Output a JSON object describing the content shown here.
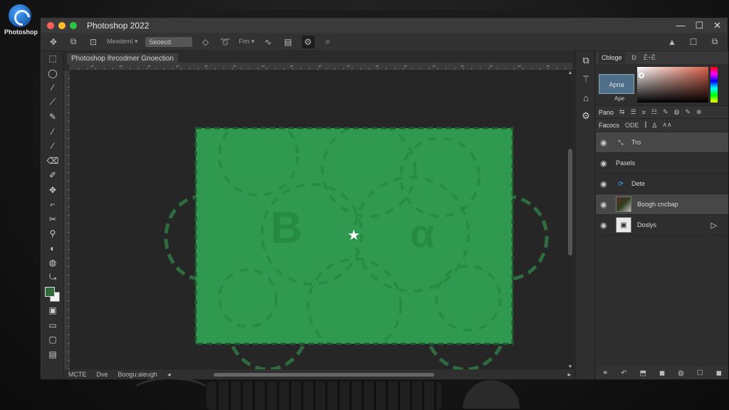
{
  "app": {
    "name": "Photoshop 2022",
    "logo_label": "Photoshop"
  },
  "window_controls": {
    "minimize": "—",
    "restore": "☐",
    "close": "✕"
  },
  "options_bar": {
    "icons": [
      "move-tool-icon",
      "arrange-icon",
      "lock-icon"
    ],
    "mode_label": "Mexdeml ▾",
    "select_value": "Seoecd",
    "extra_label": "Fim ▾",
    "right_icons": [
      "▲",
      "☐",
      "⧉"
    ]
  },
  "document": {
    "tab_title": "Photoshop Ihrcodmer Gnoection",
    "canvas_bg": "#262626",
    "selection_fill": "#2f9a4f",
    "marquee_color": "#2e6b3e",
    "letters": [
      "B",
      "α"
    ],
    "center_glyph": "★",
    "ruler_marks": [
      "⌐",
      "⌐",
      "⌐",
      "⌐",
      "⌐",
      "⌐",
      "⌐",
      "⌐",
      "⌐",
      "⌐",
      "⌐",
      "⌐",
      "⌐",
      "⌐",
      "⌐",
      "⌐",
      "⌐",
      "⌐",
      "⌐",
      "⌐",
      "⌐",
      "⌐",
      "⌐",
      "⌐",
      "⌐",
      "⌐"
    ]
  },
  "status_bar": {
    "zoom": "MCTE",
    "doc_label": "Dve",
    "doc_name": "Boogu:aleugh"
  },
  "toolbar": {
    "tools": [
      "⬚",
      "◯",
      "⁄",
      "⟋",
      "✎",
      "⁄",
      "⁄",
      "⌫",
      "✐",
      "✥",
      "⌐",
      "✂",
      "⚲",
      "◐",
      "◍",
      "⤿"
    ],
    "extra": [
      "▣",
      "▭",
      "▢",
      "▤"
    ],
    "fg_color": "#2e6b3e",
    "bg_color": "#f2f2f2"
  },
  "dock": {
    "icons": [
      "⧉",
      "⚚",
      "⌂",
      "⚙"
    ]
  },
  "color_panel": {
    "tabs": [
      "Cbloge",
      "Ð",
      "Ê÷Ê"
    ],
    "swatch_label": "Apna",
    "sub_label": "Ape"
  },
  "properties_bar": {
    "name": "Pano",
    "icons": [
      "⇆",
      "☰",
      "≡",
      "☷",
      "✎",
      "◍",
      "✎",
      "⊕"
    ]
  },
  "layers_bar": {
    "name": "Facocs",
    "icons": [
      "ODE",
      "⫿",
      "Δ",
      "∧∧"
    ]
  },
  "layers": [
    {
      "name": "Tro",
      "thumb": "",
      "fx": "⤡",
      "selected": true,
      "end": ""
    },
    {
      "name": "Pasels",
      "thumb": "",
      "fx": "",
      "selected": false,
      "end": ""
    },
    {
      "name": "Dete",
      "thumb": "",
      "fx": "⟳",
      "selected": false,
      "end": ""
    },
    {
      "name": "Boogh cncbap",
      "thumb": "photo",
      "fx": "",
      "selected": true,
      "end": ""
    },
    {
      "name": "Doslys",
      "thumb": "▣",
      "fx": "",
      "selected": false,
      "end": "▷"
    }
  ],
  "layers_footer": [
    "⚭",
    "↶",
    "⬒",
    "◼",
    "◍",
    "☐",
    "◼"
  ]
}
